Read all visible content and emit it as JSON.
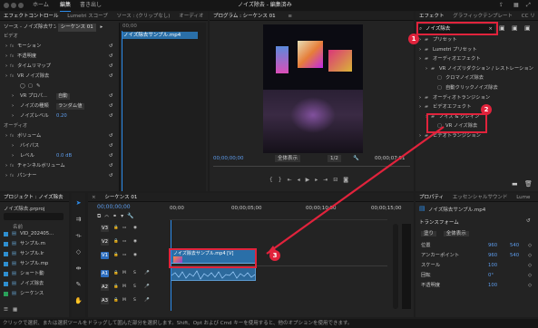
{
  "menu": {
    "home": "ホーム",
    "edit": "編集",
    "export": "書き出し",
    "title": "ノイズ除去 - 編集済み"
  },
  "colors": {
    "accent": "#2d8ceb",
    "annotation": "#e1233c",
    "clip_video": "#2a6fa8",
    "clip_audio": "#2d6a9c"
  },
  "ec": {
    "tabs": [
      "エフェクトコントロール",
      "Lumetri スコープ",
      "ソース : (クリップなし)",
      "オーディオ"
    ],
    "source": "ソース - ノイズ除去サンプル.mp4",
    "seq": "シーケンス 01",
    "clip_name": "ノイズ除去サンプル.mp4",
    "tc": "00;00",
    "rows": [
      {
        "t": "ビデオ",
        "i": 0
      },
      {
        "t": "モーション",
        "i": 1
      },
      {
        "t": "不透明度",
        "i": 1
      },
      {
        "t": "タイムリマップ",
        "i": 1
      },
      {
        "t": "VR ノイズ除去",
        "i": 1
      },
      {
        "t": "",
        "i": 2,
        "icons": true
      },
      {
        "t": "VR プロパ...",
        "i": 2,
        "v": "自動"
      },
      {
        "t": "ノイズの種類",
        "i": 2,
        "v": "ランダム値"
      },
      {
        "t": "ノイズレベル",
        "i": 2,
        "v": "0.20",
        "blue": true
      },
      {
        "t": "オーディオ",
        "i": 0
      },
      {
        "t": "ボリューム",
        "i": 1
      },
      {
        "t": "バイパス",
        "i": 2
      },
      {
        "t": "レベル",
        "i": 2,
        "v": "0.0 dB",
        "blue": true
      },
      {
        "t": "チャンネルボリューム",
        "i": 1
      },
      {
        "t": "パンナー",
        "i": 1
      }
    ]
  },
  "program": {
    "title": "プログラム : シーケンス 01",
    "tc_in": "00;00;00;00",
    "fit": "全体表示",
    "ratio": "1/2",
    "tc_out": "00;00;07;01"
  },
  "effects": {
    "tabs": [
      "エフェクト",
      "グラフィックテンプレート",
      "CC リ"
    ],
    "search": "ノイズ除去",
    "tree": [
      {
        "t": "プリセット",
        "i": 0,
        "type": "folder"
      },
      {
        "t": "Lumetri プリセット",
        "i": 0,
        "type": "folder"
      },
      {
        "t": "オーディオエフェクト",
        "i": 0,
        "type": "folder"
      },
      {
        "t": "VR ノイズリダクション / レストレーション",
        "i": 1,
        "type": "folder"
      },
      {
        "t": "クロマノイズ除去",
        "i": 2,
        "type": "fx"
      },
      {
        "t": "自動クリックノイズ除去",
        "i": 2,
        "type": "fx"
      },
      {
        "t": "オーディオトランジション",
        "i": 0,
        "type": "folder"
      },
      {
        "t": "ビデオエフェクト",
        "i": 0,
        "type": "folder"
      },
      {
        "t": "ノイズ & グレイン",
        "i": 1,
        "type": "folder"
      },
      {
        "t": "VR ノイズ除去",
        "i": 2,
        "type": "fx"
      },
      {
        "t": "ビデオトランジション",
        "i": 0,
        "type": "folder"
      }
    ]
  },
  "project": {
    "tabs": [
      "プロジェクト : ノイズ除去",
      "メ"
    ],
    "file": "ノイズ除去.prproj",
    "col": "名前",
    "items": [
      {
        "name": "VID_202405...",
        "color": "#2f8fd0"
      },
      {
        "name": "サンプル.m",
        "color": "#2f8fd0"
      },
      {
        "name": "サンプル.lr",
        "color": "#2f8fd0"
      },
      {
        "name": "サンプル.mp",
        "color": "#2f8fd0"
      },
      {
        "name": "ショート動",
        "color": "#2f8fd0"
      },
      {
        "name": "ノイズ除去",
        "color": "#2f8fd0"
      },
      {
        "name": "シーケンス",
        "color": "#2aa05a"
      }
    ]
  },
  "timeline": {
    "tab": "シーケンス 01",
    "tc": "00;00;00;00",
    "ruler": [
      "00;00",
      "00;00;05;00",
      "00;00;10;00",
      "00;00;15;00"
    ],
    "video_tracks": [
      "V3",
      "V2",
      "V1"
    ],
    "audio_tracks": [
      "A1",
      "A2",
      "A3"
    ],
    "clip_label": "ノイズ除去サンプル.mp4 [V]"
  },
  "properties": {
    "tabs": [
      "プロパティ",
      "エッセンシャルサウンド",
      "Lume"
    ],
    "clip": "ノイズ除去サンプル.mp4",
    "section": "トランスフォーム",
    "fill": "塗り",
    "fill_all": "全体表示",
    "rows": [
      {
        "t": "位置",
        "v1": "960",
        "v2": "540"
      },
      {
        "t": "アンカーポイント",
        "v1": "960",
        "v2": "540"
      },
      {
        "t": "スケール",
        "v1": "100"
      },
      {
        "t": "回転",
        "v1": "0°"
      },
      {
        "t": "不透明度",
        "v1": "100"
      }
    ]
  },
  "statusbar": "クリックで選択、または選択ツールをドラッグして囲んだ部分を選択します。Shift、Opt および Cmd キーを使用すると、他のオプションを使用できます。",
  "badges": [
    "1",
    "2",
    "3"
  ]
}
